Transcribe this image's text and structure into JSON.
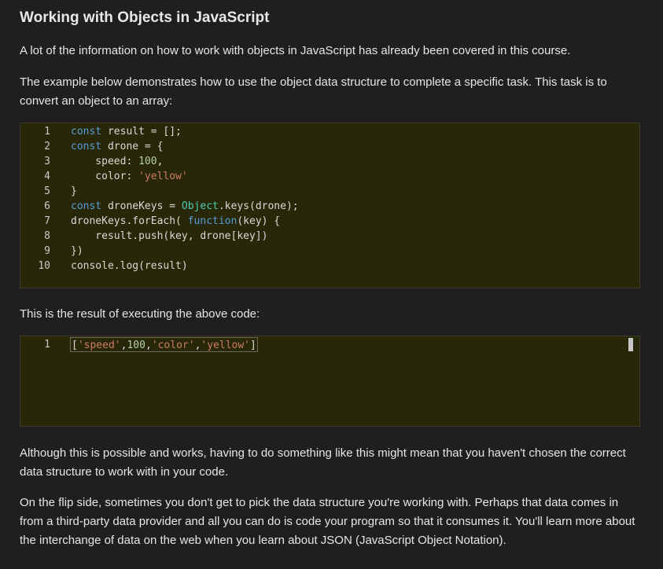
{
  "title": "Working with Objects in JavaScript",
  "paragraphs": {
    "p1": "A lot of the information on how to work with objects in JavaScript has already been covered in this course.",
    "p2": "The example below demonstrates how to use the object data structure to complete a specific task. This task is to convert an object to an array:",
    "p3": "This is the result of executing the above code:",
    "p4": "Although this is possible and works, having to do something like this might mean that you haven't chosen the correct data structure to work with in your code.",
    "p5": "On the flip side, sometimes you don't get to pick the data structure you're working with. Perhaps that data comes in from a third-party data provider and all you can do is code your program so that it consumes it. You'll learn more about the interchange of data on the web when you learn about JSON (JavaScript Object Notation)."
  },
  "code": {
    "line_numbers": [
      "1",
      "2",
      "3",
      "4",
      "5",
      "6",
      "7",
      "8",
      "9",
      "10"
    ],
    "lines": [
      "const result = [];",
      "const drone = {",
      "    speed: 100,",
      "    color: 'yellow'",
      "}",
      "const droneKeys = Object.keys(drone);",
      "droneKeys.forEach( function(key) {",
      "    result.push(key, drone[key])",
      "})",
      "console.log(result)"
    ]
  },
  "output": {
    "line_number": "1",
    "text": "['speed',100,'color','yellow']"
  },
  "colors": {
    "background": "#1f1f21",
    "code_background": "#282808",
    "keyword": "#569cd6",
    "number": "#b5cea8",
    "string": "#ce7a64",
    "object": "#4ec9b0"
  }
}
